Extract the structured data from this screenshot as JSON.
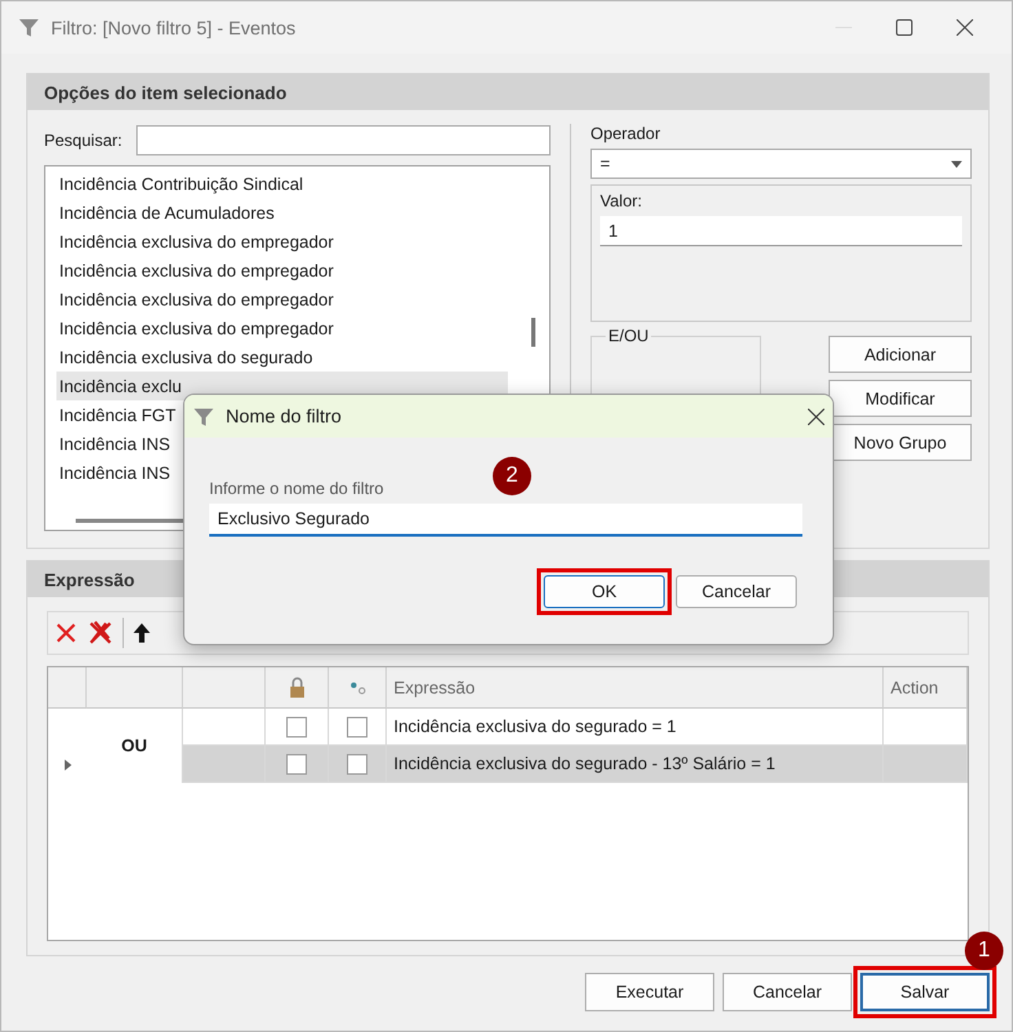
{
  "window": {
    "title": "Filtro: [Novo filtro 5] - Eventos"
  },
  "options_panel": {
    "title": "Opções do item selecionado",
    "search_label": "Pesquisar:",
    "items": [
      {
        "label": "Incidência Contribuição Sindical",
        "selected": false
      },
      {
        "label": "Incidência de Acumuladores",
        "selected": false
      },
      {
        "label": "Incidência exclusiva do empregador",
        "selected": false
      },
      {
        "label": "Incidência exclusiva do empregador",
        "selected": false
      },
      {
        "label": "Incidência exclusiva do empregador",
        "selected": false
      },
      {
        "label": "Incidência exclusiva do empregador",
        "selected": false
      },
      {
        "label": "Incidência exclusiva do segurado",
        "selected": false
      },
      {
        "label": "Incidência exclu",
        "selected": true
      },
      {
        "label": "Incidência FGT",
        "selected": false
      },
      {
        "label": "Incidência INS",
        "selected": false
      },
      {
        "label": "Incidência INS",
        "selected": false
      }
    ],
    "operator": {
      "label": "Operador",
      "value": "="
    },
    "value_field": {
      "label": "Valor:",
      "value": "1"
    },
    "and_or": {
      "label": "E/OU"
    },
    "buttons": [
      {
        "label": "Adicionar"
      },
      {
        "label": "Modificar"
      },
      {
        "label": "Novo Grupo"
      }
    ]
  },
  "expression_panel": {
    "title": "Expressão",
    "columns": [
      "Expressão",
      "Action"
    ],
    "group_label": "OU",
    "rows": [
      {
        "expression": "Incidência exclusiva do segurado = 1",
        "selected": false,
        "locked": false,
        "flagged": false
      },
      {
        "expression": "Incidência exclusiva do segurado - 13º Salário = 1",
        "selected": true,
        "locked": false,
        "flagged": false
      }
    ]
  },
  "footer_buttons": [
    {
      "label": "Executar",
      "highlighted": false,
      "focused": false
    },
    {
      "label": "Cancelar",
      "highlighted": false,
      "focused": false
    },
    {
      "label": "Salvar",
      "highlighted": true,
      "focused": true,
      "step": "1"
    }
  ],
  "dialog": {
    "title": "Nome do filtro",
    "step": "2",
    "label": "Informe o nome do filtro",
    "value": "Exclusivo Segurado",
    "buttons": [
      {
        "label": "OK",
        "highlighted": true,
        "focused": true
      },
      {
        "label": "Cancelar",
        "highlighted": false,
        "focused": false
      }
    ]
  }
}
